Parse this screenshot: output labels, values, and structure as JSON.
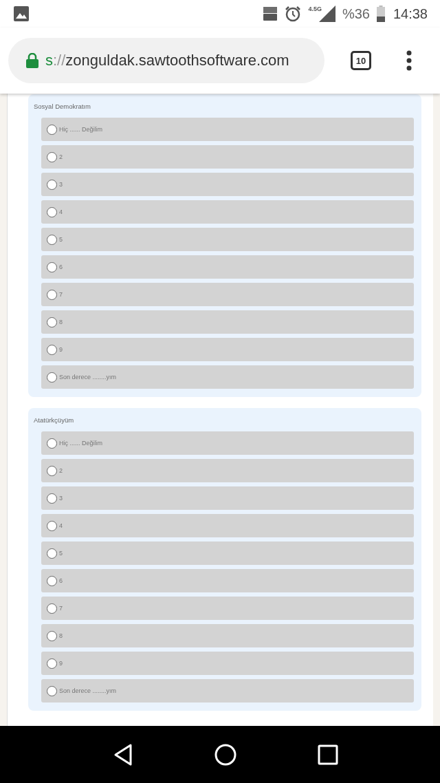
{
  "status_bar": {
    "network": "4.5G",
    "battery": "%36",
    "time": "14:38"
  },
  "address_bar": {
    "scheme": "s",
    "separator": "://",
    "host": "zonguldak.sawtoothsoftware.com",
    "tab_count": "10"
  },
  "questions": [
    {
      "label": "Sosyal Demokratım",
      "options": [
        {
          "label": "Hiç ...... Değilim",
          "selected": false
        },
        {
          "label": "2",
          "selected": false
        },
        {
          "label": "3",
          "selected": false
        },
        {
          "label": "4",
          "selected": false
        },
        {
          "label": "5",
          "selected": false
        },
        {
          "label": "6",
          "selected": false
        },
        {
          "label": "7",
          "selected": false
        },
        {
          "label": "8",
          "selected": false
        },
        {
          "label": "9",
          "selected": false
        },
        {
          "label": "Son derece ........yım",
          "selected": false
        }
      ]
    },
    {
      "label": "Atatürkçüyüm",
      "options": [
        {
          "label": "Hiç ...... Değilim",
          "selected": false
        },
        {
          "label": "2",
          "selected": false
        },
        {
          "label": "3",
          "selected": false
        },
        {
          "label": "4",
          "selected": false
        },
        {
          "label": "5",
          "selected": false
        },
        {
          "label": "6",
          "selected": false
        },
        {
          "label": "7",
          "selected": false
        },
        {
          "label": "8",
          "selected": false
        },
        {
          "label": "9",
          "selected": false
        },
        {
          "label": "Son derece ........yım",
          "selected": false
        }
      ]
    }
  ]
}
